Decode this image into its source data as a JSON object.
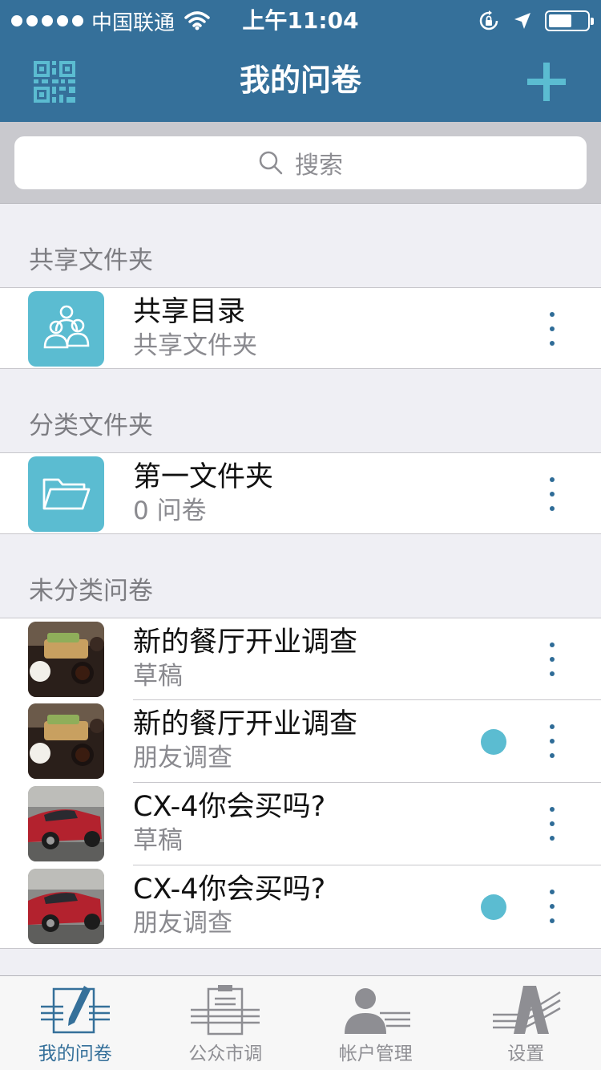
{
  "status_bar": {
    "carrier": "中国联通",
    "time": "上午11:04",
    "battery_level": 0.6
  },
  "nav": {
    "title": "我的问卷",
    "left_icon": "qr-code-icon",
    "right_icon": "plus-icon"
  },
  "search": {
    "placeholder": "搜索"
  },
  "sections": {
    "shared": {
      "header": "共享文件夹",
      "item": {
        "title": "共享目录",
        "subtitle": "共享文件夹",
        "icon": "users-icon"
      }
    },
    "category": {
      "header": "分类文件夹",
      "item": {
        "title": "第一文件夹",
        "subtitle": "0 问卷",
        "icon": "folder-icon"
      }
    },
    "uncategorized": {
      "header": "未分类问卷",
      "items": [
        {
          "title": "新的餐厅开业调查",
          "subtitle": "草稿",
          "thumb": "food-photo",
          "badge": false
        },
        {
          "title": "新的餐厅开业调查",
          "subtitle": "朋友调查",
          "thumb": "food-photo",
          "badge": true
        },
        {
          "title": "CX-4你会买吗?",
          "subtitle": "草稿",
          "thumb": "car-photo",
          "badge": false
        },
        {
          "title": "CX-4你会买吗?",
          "subtitle": "朋友调查",
          "thumb": "car-photo",
          "badge": true
        }
      ]
    }
  },
  "tabs": [
    {
      "label": "我的问卷",
      "icon": "survey-edit-icon",
      "active": true
    },
    {
      "label": "公众市调",
      "icon": "clipboard-icon",
      "active": false
    },
    {
      "label": "帐户管理",
      "icon": "account-icon",
      "active": false
    },
    {
      "label": "设置",
      "icon": "settings-logo-icon",
      "active": false
    }
  ],
  "colors": {
    "brand": "#35709a",
    "accent": "#5bbcd1",
    "background": "#efeff4"
  }
}
